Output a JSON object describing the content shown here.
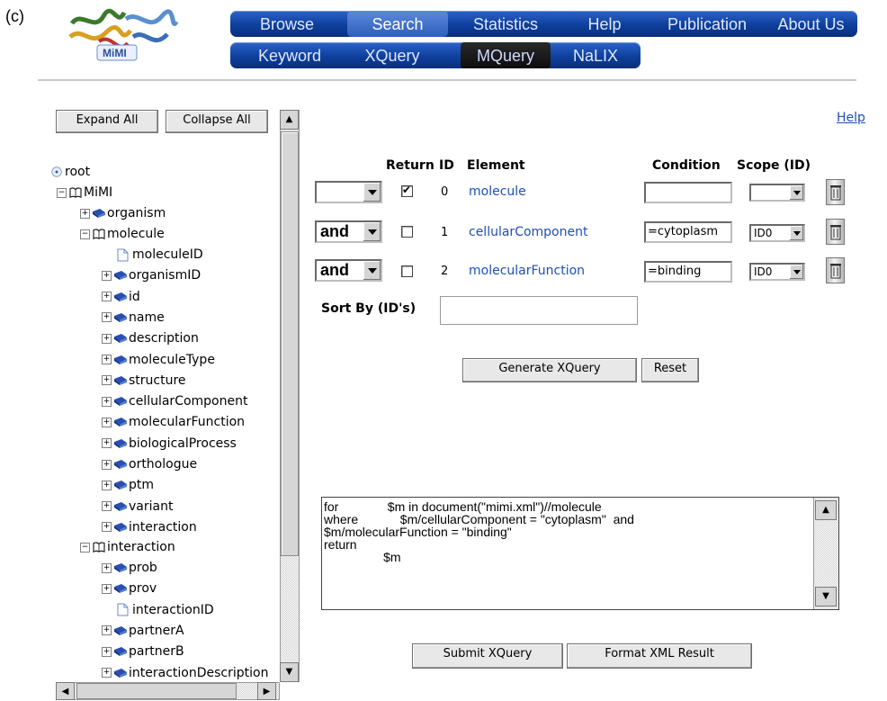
{
  "figure_label": "(c)",
  "logo": {
    "text": "MiMI"
  },
  "nav": {
    "top": [
      "Browse",
      "Search",
      "Statistics",
      "Help",
      "Publication",
      "About Us"
    ],
    "sub": [
      "Keyword",
      "XQuery",
      "MQuery",
      "NaLIX"
    ]
  },
  "tree": {
    "expand_all": "Expand All",
    "collapse_all": "Collapse All",
    "root": "root",
    "mimi": "MiMI",
    "organism": "organism",
    "molecule": "molecule",
    "molecule_children": [
      "moleculeID",
      "organismID",
      "id",
      "name",
      "description",
      "moleculeType",
      "structure",
      "cellularComponent",
      "molecularFunction",
      "biologicalProcess",
      "orthologue",
      "ptm",
      "variant",
      "interaction"
    ],
    "interaction": "interaction",
    "interaction_children": [
      "prob",
      "prov",
      "interactionID",
      "partnerA",
      "partnerB",
      "interactionDescription"
    ]
  },
  "query": {
    "help": "Help",
    "headers": {
      "return": "Return",
      "id": "ID",
      "element": "Element",
      "condition": "Condition",
      "scope": "Scope (ID)"
    },
    "rows": [
      {
        "op": "",
        "return": true,
        "id": "0",
        "element": "molecule",
        "condition": "",
        "scope": ""
      },
      {
        "op": "and",
        "return": false,
        "id": "1",
        "element": "cellularComponent",
        "condition": "=cytoplasm",
        "scope": "ID0"
      },
      {
        "op": "and",
        "return": false,
        "id": "2",
        "element": "molecularFunction",
        "condition": "=binding",
        "scope": "ID0"
      }
    ],
    "sort_by": "Sort By (ID's)",
    "generate": "Generate XQuery",
    "reset": "Reset",
    "xquery_text": "for              $m in document(\"mimi.xml\")//molecule\nwhere            $m/cellularComponent = \"cytoplasm\"  and\n$m/molecularFunction = \"binding\"\nreturn\n                 $m",
    "submit": "Submit XQuery",
    "format": "Format XML Result"
  }
}
